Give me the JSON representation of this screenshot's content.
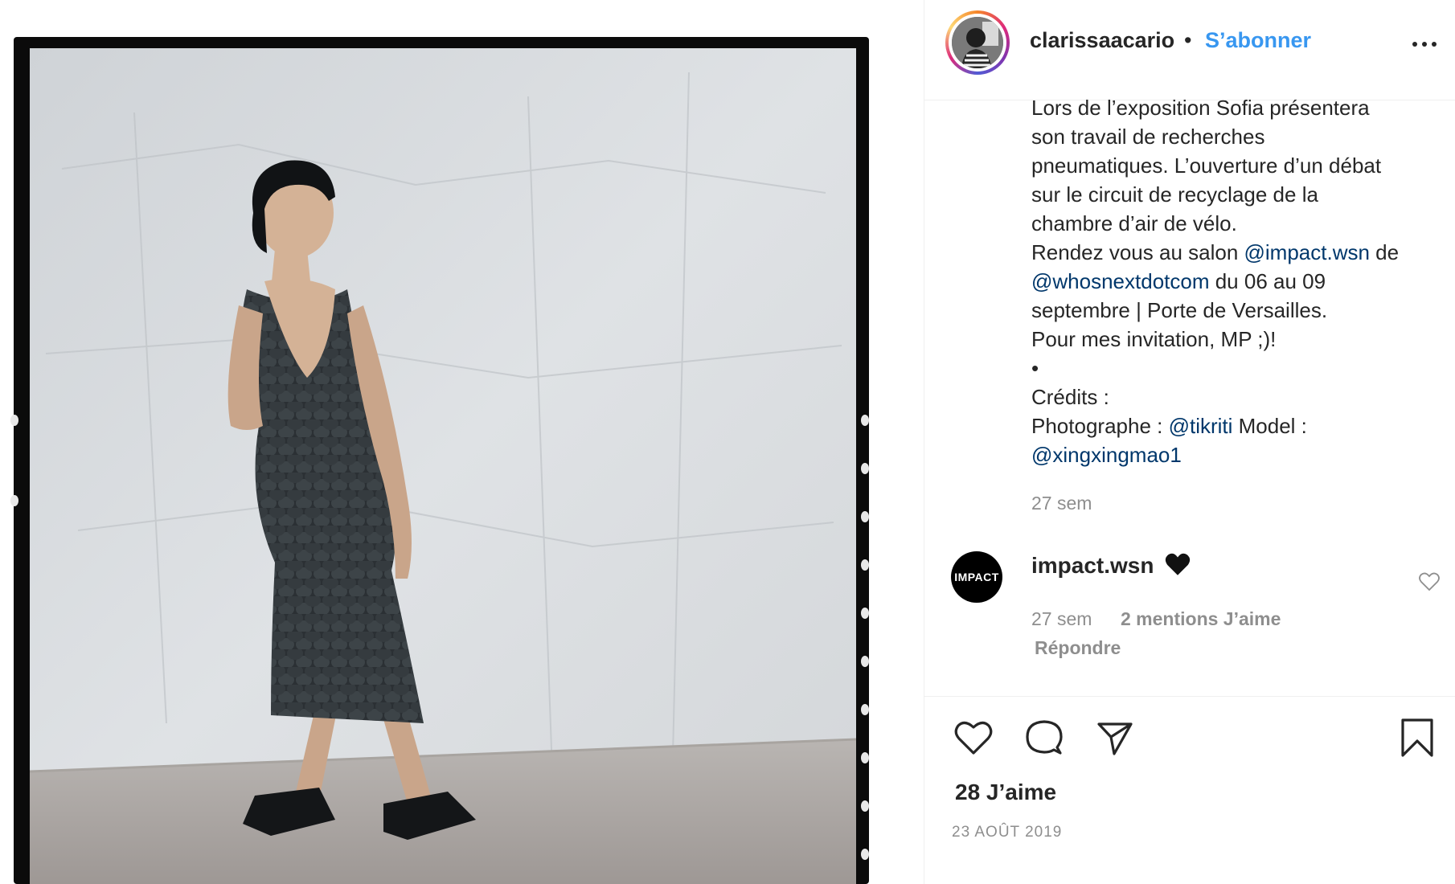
{
  "post": {
    "username": "clarissaacario",
    "separator": "•",
    "follow_label": "S’abonner",
    "caption_lines": [
      "Lors de l’exposition Sofia présentera",
      "son travail de recherches",
      "pneumatiques. L’ouverture d’un débat",
      "sur le circuit de recyclage de la",
      "chambre d’air de vélo."
    ],
    "caption_rendez": {
      "before": "Rendez vous au salon ",
      "mention1": "@impact.wsn",
      "after1": " de",
      "mention2": "@whosnextdotcom",
      "after2": " du 06 au 09",
      "line3": "septembre | Porte de Versailles.",
      "line4": "Pour mes invitation, MP ;)!",
      "bullet": "•",
      "credits": "Crédits :",
      "photo_prefix": "Photographe : ",
      "photo_mention": "@tikriti",
      "model_label": " Model :",
      "model_mention": "@xingxingmao1"
    },
    "caption_time": "27 sem",
    "likes": "28 J’aime",
    "date": "23 AOÛT 2019"
  },
  "comment": {
    "avatar_text": "IMPACT",
    "username": "impact.wsn",
    "emoji": "black-heart",
    "time": "27 sem",
    "likes": "2 mentions J’aime",
    "reply_label": "Répondre"
  },
  "colors": {
    "accent_link": "#3897f0",
    "mention": "#00376b",
    "muted": "#8e8e8e",
    "text": "#262626"
  },
  "icons": [
    "more-options-icon",
    "heart-icon",
    "comment-icon",
    "share-icon",
    "bookmark-icon",
    "like-comment-icon"
  ]
}
